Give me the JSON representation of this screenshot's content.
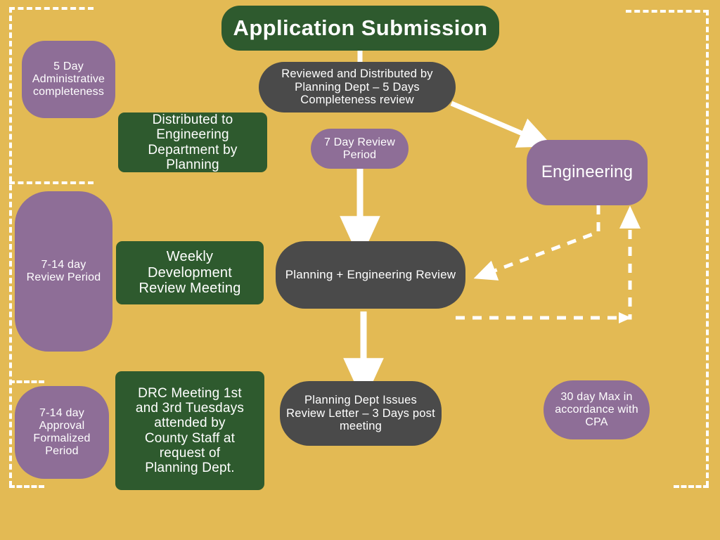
{
  "diagram": {
    "title": "Application Submission",
    "background_color": "#E3BA54",
    "palette": {
      "green": "#2E5A2E",
      "dark": "#4A4A4A",
      "purple": "#8E6E97",
      "line": "#FFFFFF"
    }
  },
  "nodes": {
    "title": "Application Submission",
    "reviewed_distributed": "Reviewed and Distributed by\nPlanning Dept – 5 Days\nCompleteness review",
    "engineering": "Engineering",
    "distributed_to_engineering": "Distributed to\nEngineering\nDepartment by\nPlanning",
    "weekly_development_review": "Weekly\nDevelopment\nReview Meeting",
    "planning_engineering_review": "Planning + Engineering Review",
    "drc_meeting": "DRC Meeting 1st\nand 3rd Tuesdays\nattended by\nCounty Staff at\nrequest of\nPlanning Dept.",
    "review_letter": "Planning Dept Issues\nReview Letter – 3 Days post\nmeeting"
  },
  "badges": {
    "admin_completeness": "5 Day\nAdministrative\ncompleteness",
    "seven_day_review": "7 Day Review\nPeriod",
    "review_period": "7-14 day\nReview Period",
    "approval_formalized": "7-14 day\nApproval\nFormalized\nPeriod",
    "cpa_max": "30 day Max in\naccordance with\nCPA"
  }
}
